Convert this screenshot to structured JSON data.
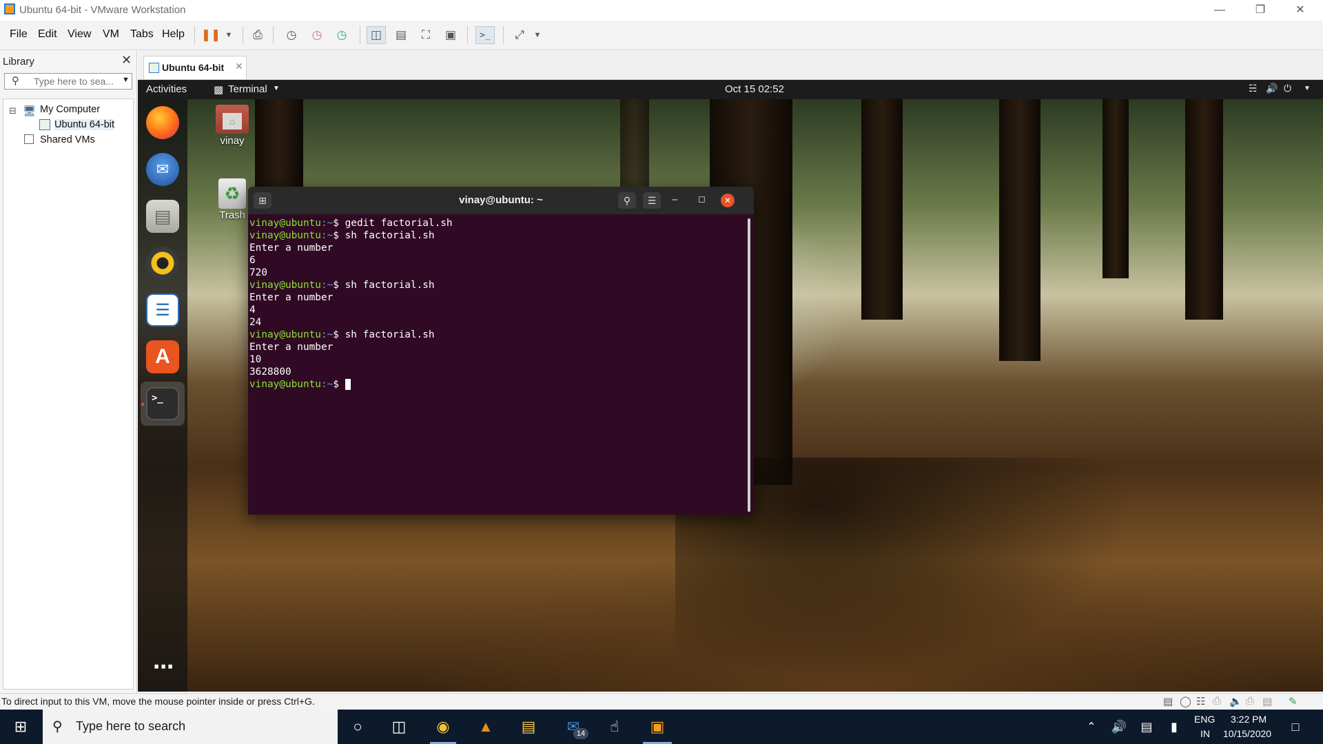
{
  "window": {
    "title": "Ubuntu 64-bit - VMware Workstation"
  },
  "menu": [
    "File",
    "Edit",
    "View",
    "VM",
    "Tabs",
    "Help"
  ],
  "library": {
    "title": "Library",
    "search_placeholder": "Type here to sea...",
    "tree": [
      {
        "label": "My Computer",
        "expander": "⊟"
      },
      {
        "label": "Ubuntu 64-bit"
      },
      {
        "label": "Shared VMs"
      }
    ]
  },
  "vm_tab": {
    "label": "Ubuntu 64-bit"
  },
  "ubuntu": {
    "activities": "Activities",
    "app_menu": "Terminal",
    "clock": "Oct 15  02:52"
  },
  "desktop_icons": [
    {
      "label": "vinay",
      "icon": "home-folder-icon"
    },
    {
      "label": "Trash",
      "icon": "trash-icon"
    }
  ],
  "dock_apps": [
    "firefox-icon",
    "thunderbird-icon",
    "files-icon",
    "rhythmbox-icon",
    "libreoffice-writer-icon",
    "ubuntu-software-icon",
    "terminal-icon",
    "show-applications-icon"
  ],
  "terminal": {
    "title": "vinay@ubuntu: ~",
    "lines": [
      {
        "prompt": "vinay@ubuntu",
        "path": ":~",
        "cmd": "$ gedit factorial.sh"
      },
      {
        "prompt": "vinay@ubuntu",
        "path": ":~",
        "cmd": "$ sh factorial.sh"
      },
      {
        "text": "Enter a number"
      },
      {
        "text": "6"
      },
      {
        "text": "720"
      },
      {
        "prompt": "vinay@ubuntu",
        "path": ":~",
        "cmd": "$ sh factorial.sh"
      },
      {
        "text": "Enter a number"
      },
      {
        "text": "4"
      },
      {
        "text": "24"
      },
      {
        "prompt": "vinay@ubuntu",
        "path": ":~",
        "cmd": "$ sh factorial.sh"
      },
      {
        "text": "Enter a number"
      },
      {
        "text": "10"
      },
      {
        "text": "3628800"
      },
      {
        "prompt": "vinay@ubuntu",
        "path": ":~",
        "cmd": "$ ",
        "cursor": true
      }
    ]
  },
  "statusbar": {
    "text": "To direct input to this VM, move the mouse pointer inside or press Ctrl+G."
  },
  "taskbar": {
    "search_placeholder": "Type here to search",
    "lang_top": "ENG",
    "lang_bottom": "IN",
    "time": "3:22 PM",
    "date": "10/15/2020",
    "mail_badge": "14"
  },
  "colors": {
    "terminal_bg": "#300a24",
    "prompt": "#8ae234",
    "taskbar": "#0d1a2b"
  }
}
